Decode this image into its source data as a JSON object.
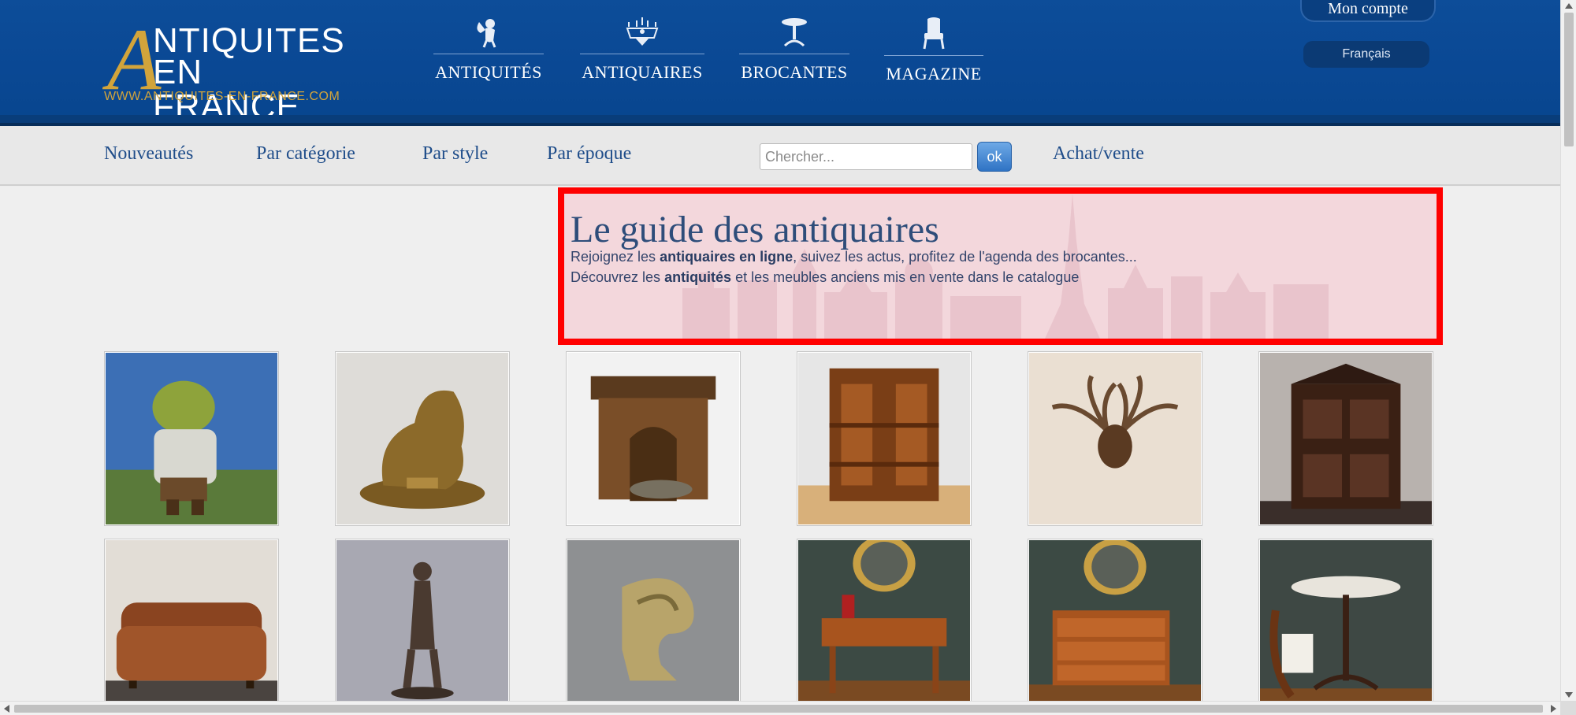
{
  "header": {
    "logo": {
      "initial": "A",
      "line1": "NTIQUITES",
      "line2": "EN FRANCE",
      "url": "WWW.ANTIQUITES-EN-FRANCE.COM"
    },
    "nav": [
      {
        "label": "ANTIQUITÉS",
        "icon": "cherub-icon"
      },
      {
        "label": "ANTIQUAIRES",
        "icon": "chandelier-icon"
      },
      {
        "label": "BROCANTES",
        "icon": "pedestal-table-icon"
      },
      {
        "label": "MAGAZINE",
        "icon": "armchair-icon"
      }
    ],
    "account": "Mon compte",
    "language": "Français"
  },
  "subnav": {
    "links": [
      "Nouveautés",
      "Par catégorie",
      "Par style",
      "Par époque"
    ],
    "search_placeholder": "Chercher...",
    "search_button": "ok",
    "achat_vente": "Achat/vente"
  },
  "guide": {
    "title": "Le guide des antiquaires",
    "line1_pre": "Rejoignez les ",
    "line1_bold": "antiquaires en ligne",
    "line1_post": ", suivez les actus, profitez de l'agenda des brocantes...",
    "line2_pre": "Découvrez les ",
    "line2_bold": "antiquités",
    "line2_post": " et les meubles anciens mis en vente dans le catalogue"
  },
  "colors": {
    "header_blue": "#0a4894",
    "gold": "#d2a43b",
    "link_blue": "#1f4d8a",
    "highlight_red": "#ff0000"
  }
}
